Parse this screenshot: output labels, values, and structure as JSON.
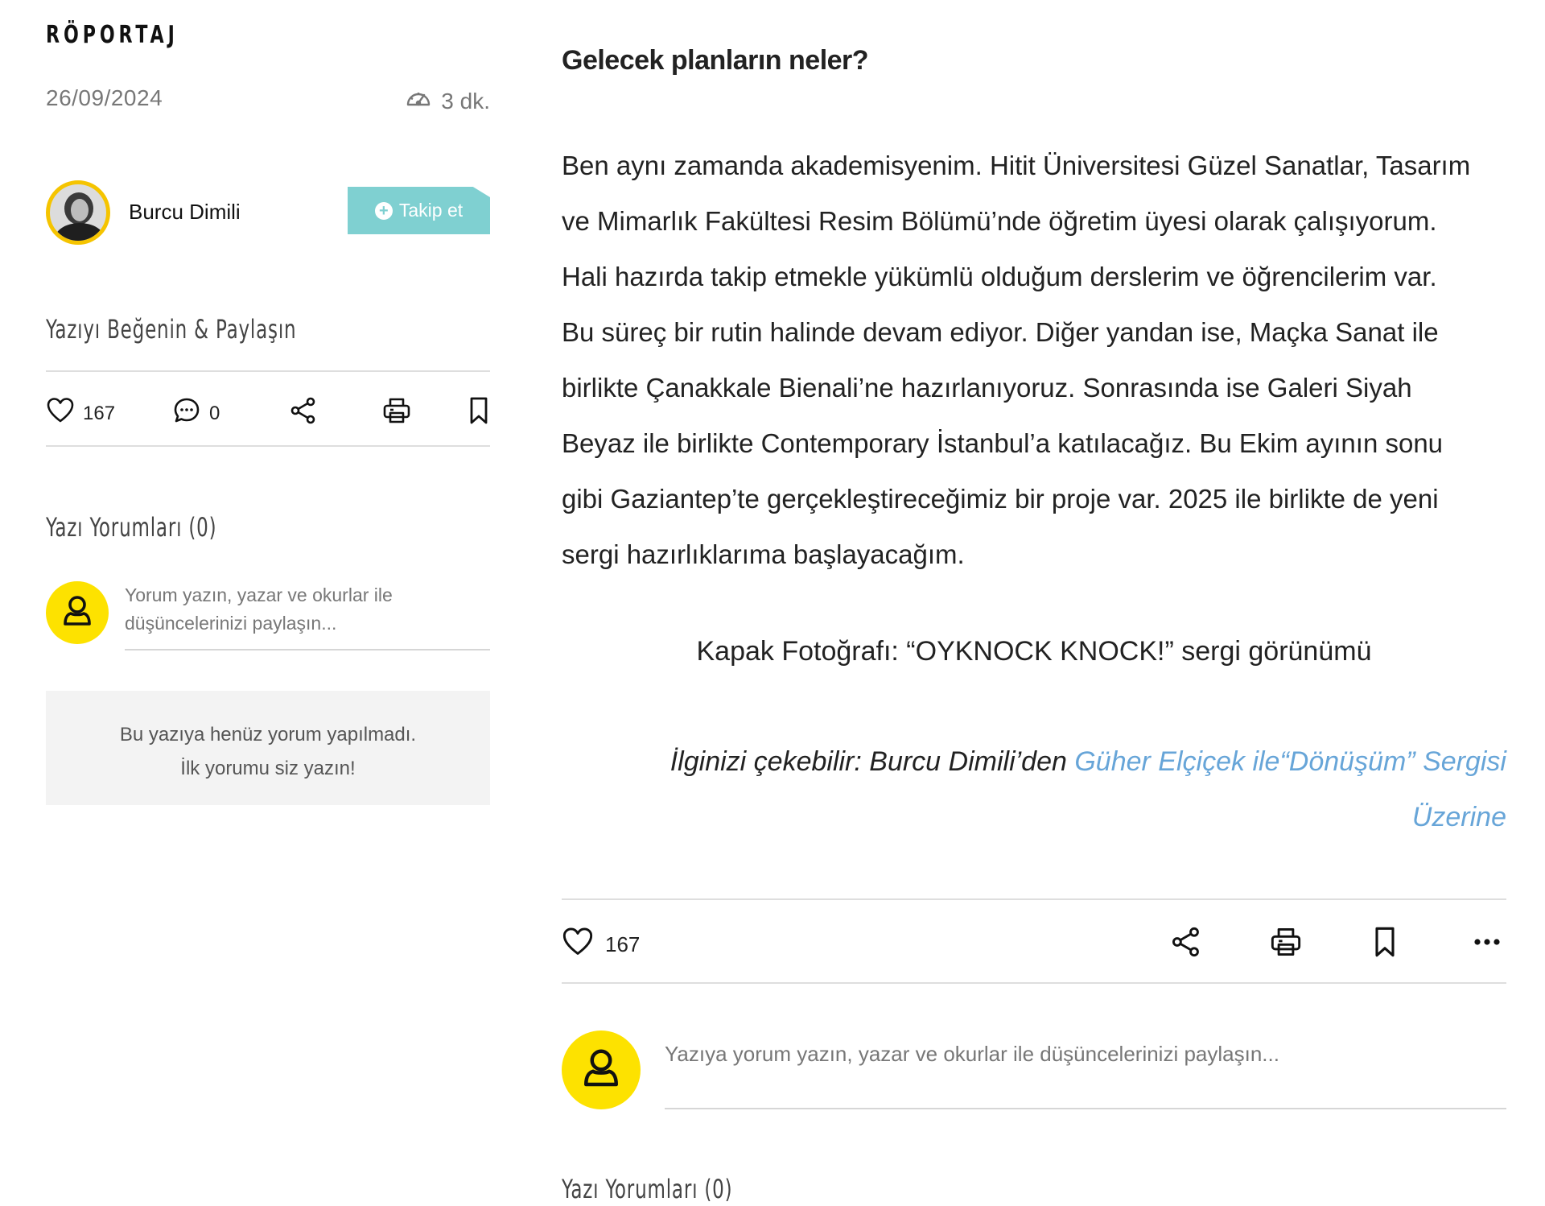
{
  "sidebar": {
    "category": "RÖPORTAJ",
    "date": "26/09/2024",
    "read_time": "3 dk.",
    "author": {
      "name": "Burcu Dimili",
      "follow_label": "Takip et"
    },
    "share_title": "Yazıyı Beğenin & Paylaşın",
    "actions": {
      "like_count": "167",
      "comment_count": "0"
    },
    "comments_title": "Yazı Yorumları (0)",
    "comment_placeholder": "Yorum yazın, yazar ve okurlar ile düşüncelerinizi paylaşın...",
    "empty_message": {
      "line1": "Bu yazıya henüz yorum yapılmadı.",
      "line2": "İlk yorumu siz yazın!"
    }
  },
  "article": {
    "question": "Gelecek planların neler?",
    "paragraph_lines": [
      "Ben aynı zamanda akademisyenim. Hitit Üniversitesi Güzel Sanatlar, Tasarım",
      "ve Mimarlık Fakültesi Resim Bölümü’nde öğretim üyesi olarak çalışıyorum.",
      "Hali hazırda takip etmekle yükümlü olduğum derslerim ve öğrencilerim var.",
      "Bu süreç bir rutin halinde devam ediyor. Diğer yandan ise, Maçka Sanat ile",
      "birlikte Çanakkale Bienali’ne hazırlanıyoruz. Sonrasında ise Galeri Siyah",
      "Beyaz ile birlikte Contemporary İstanbul’a katılacağız. Bu Ekim ayının sonu",
      "gibi Gaziantep’te gerçekleştireceğimiz bir proje var. 2025 ile birlikte de yeni",
      "sergi hazırlıklarıma başlayacağım."
    ],
    "caption": "Kapak Fotoğrafı: “OYKNOCK KNOCK!” sergi görünümü",
    "related": {
      "prefix": "İlginizi çekebilir: Burcu Dimili’den ",
      "link_line1": "Güher Elçiçek ile“Dönüşüm” Sergisi",
      "link_line2": "Üzerine"
    },
    "actions": {
      "like_count": "167"
    },
    "comment_placeholder": "Yazıya yorum yazın, yazar ve okurlar ile düşüncelerinizi paylaşın...",
    "comments_title": "Yazı Yorumları (0)"
  },
  "colors": {
    "accent_yellow": "#fde200",
    "follow_teal": "#7fd0d1",
    "link_blue": "#67a5d8"
  },
  "icons": [
    "speedometer-icon",
    "plus-circle-icon",
    "heart-icon",
    "comment-icon",
    "share-icon",
    "print-icon",
    "bookmark-icon",
    "more-icon",
    "user-icon"
  ]
}
